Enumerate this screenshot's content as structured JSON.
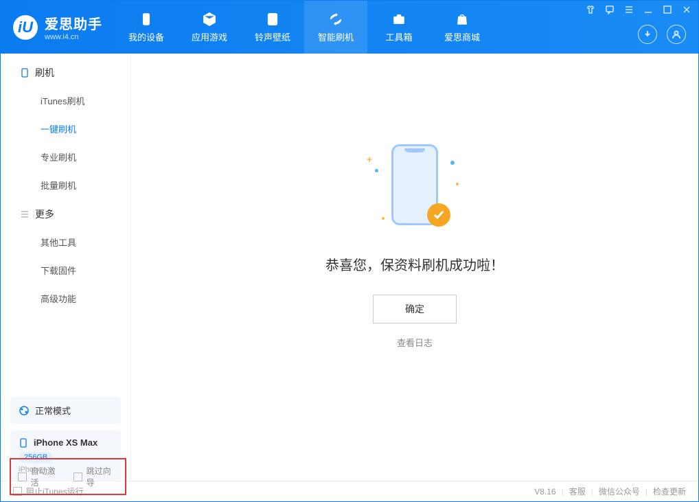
{
  "app": {
    "title": "爱思助手",
    "subtitle": "www.i4.cn"
  },
  "nav": {
    "items": [
      {
        "label": "我的设备"
      },
      {
        "label": "应用游戏"
      },
      {
        "label": "铃声壁纸"
      },
      {
        "label": "智能刷机"
      },
      {
        "label": "工具箱"
      },
      {
        "label": "爱思商城"
      }
    ]
  },
  "sidebar": {
    "group1": {
      "label": "刷机"
    },
    "items1": [
      {
        "label": "iTunes刷机"
      },
      {
        "label": "一键刷机"
      },
      {
        "label": "专业刷机"
      },
      {
        "label": "批量刷机"
      }
    ],
    "group2": {
      "label": "更多"
    },
    "items2": [
      {
        "label": "其他工具"
      },
      {
        "label": "下载固件"
      },
      {
        "label": "高级功能"
      }
    ],
    "status": {
      "label": "正常模式"
    },
    "device": {
      "name": "iPhone XS Max",
      "storage": "256GB",
      "type": "iPhone"
    }
  },
  "main": {
    "success_title": "恭喜您，保资料刷机成功啦！",
    "ok_button": "确定",
    "view_log": "查看日志"
  },
  "options": {
    "auto_activate": "自动激活",
    "skip_guide": "跳过向导"
  },
  "footer": {
    "block_itunes": "阻止iTunes运行",
    "version": "V8.16",
    "support": "客服",
    "wechat": "微信公众号",
    "update": "检查更新"
  }
}
